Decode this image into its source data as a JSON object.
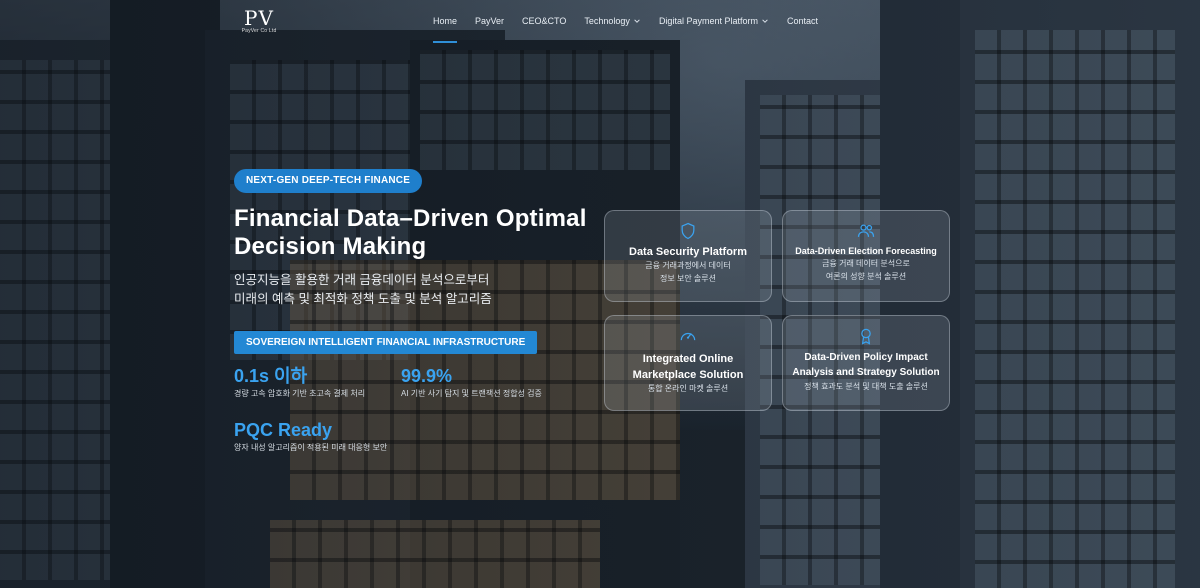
{
  "nav": {
    "logo_mark": "PV",
    "logo_sub": "PayVer Co Ltd",
    "items": [
      {
        "label": "Home",
        "active": true
      },
      {
        "label": "PayVer"
      },
      {
        "label": "CEO&CTO"
      },
      {
        "label": "Technology",
        "dropdown": true
      },
      {
        "label": "Digital Payment Platform",
        "dropdown": true
      },
      {
        "label": "Contact"
      }
    ]
  },
  "hero": {
    "badge": "NEXT-GEN DEEP-TECH FINANCE",
    "title": "Financial Data–Driven Optimal Decision Making",
    "subtitle_line1": "인공지능을 활용한 거래 금융데이터 분석으로부터",
    "subtitle_line2": "미래의 예측 및 최적화 정책 도출 및 분석 알고리즘",
    "bar": "SOVEREIGN INTELLIGENT FINANCIAL INFRASTRUCTURE",
    "stats": [
      {
        "value": "0.1s 이하",
        "desc": "경량 고속 암호화 기반 초고속 결제 처리"
      },
      {
        "value": "99.9%",
        "desc": "AI 기반 사기 탐지 및 트랜잭션 정합성 검증"
      },
      {
        "value": "PQC Ready",
        "desc": "양자 내성 알고리즘이 적용된 미래 대응형 보안"
      }
    ]
  },
  "cards": [
    {
      "icon": "shield-icon",
      "title": "Data Security Platform",
      "desc1": "금융 거래과정에서 데이터",
      "desc2": "정보 보안 솔루션"
    },
    {
      "icon": "users-icon",
      "title": "Data-Driven Election Forecasting",
      "desc1": "금융 거래 데이터 분석으로",
      "desc2": "여론의 성향 분석 솔루션"
    },
    {
      "icon": "gauge-icon",
      "title1": "Integrated Online",
      "title2": "Marketplace Solution",
      "desc1": "통합 온라인 마켓 솔루션"
    },
    {
      "icon": "award-icon",
      "title1": "Data-Driven Policy Impact",
      "title2": "Analysis and Strategy Solution",
      "desc1": "정책 효과도 분석 및 대책 도출 솔루션"
    }
  ],
  "colors": {
    "accent": "#2388d4",
    "stat": "#3aa3f0"
  }
}
